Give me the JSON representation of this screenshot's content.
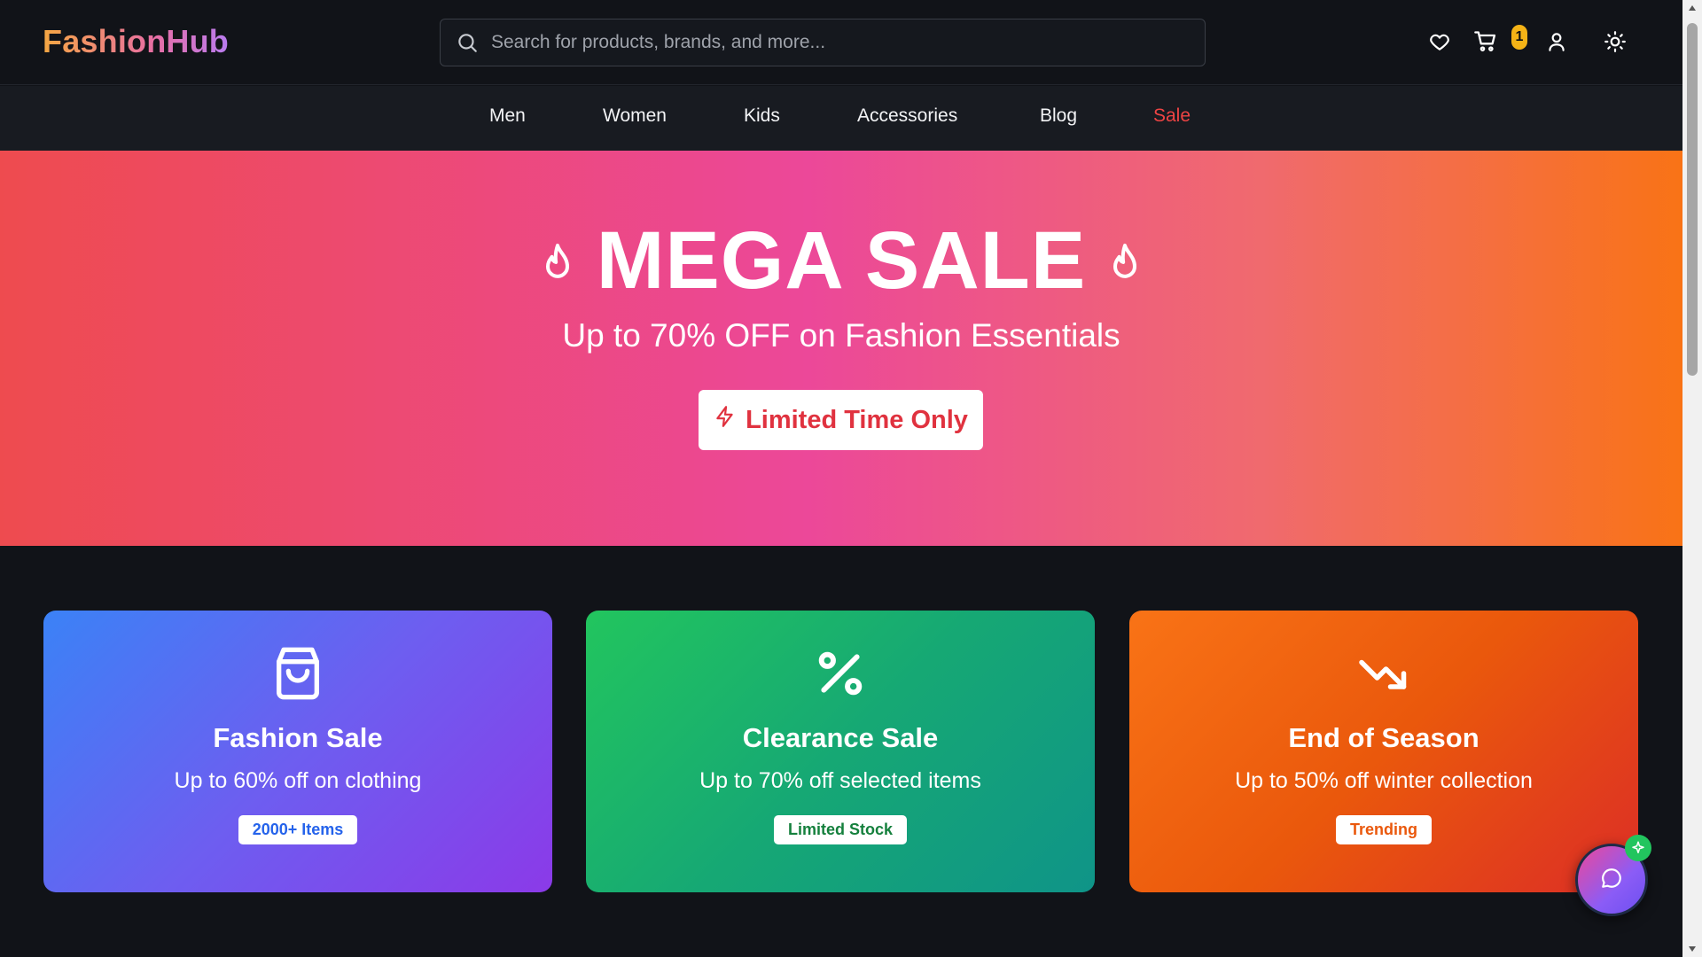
{
  "header": {
    "logo": "FashionHub",
    "search_placeholder": "Search for products, brands, and more...",
    "cart_count": "1",
    "icons": [
      "heart-icon",
      "cart-icon",
      "user-icon",
      "sun-icon"
    ]
  },
  "nav": {
    "items": [
      {
        "label": "Men"
      },
      {
        "label": "Women"
      },
      {
        "label": "Kids"
      },
      {
        "label": "Accessories"
      },
      {
        "label": "Blog"
      },
      {
        "label": "Sale",
        "color": "#ef4444"
      }
    ]
  },
  "hero": {
    "title": "MEGA SALE",
    "subtitle": "Up to 70% OFF on Fashion Essentials",
    "button_label": "Limited Time Only",
    "icons": [
      "flame-icon",
      "lightning-icon"
    ]
  },
  "cards": [
    {
      "icon": "shopping-bag-icon",
      "title": "Fashion Sale",
      "description": "Up to 60% off on clothing",
      "badge": "2000+ Items"
    },
    {
      "icon": "percent-icon",
      "title": "Clearance Sale",
      "description": "Up to 70% off selected items",
      "badge": "Limited Stock"
    },
    {
      "icon": "trending-down-icon",
      "title": "End of Season",
      "description": "Up to 50% off winter collection",
      "badge": "Trending"
    }
  ],
  "colors": {
    "background": "#111318",
    "accent_sale": "#ef4444",
    "badge": "#f5b316",
    "chat_spark": "#22c55e"
  },
  "chat": {
    "icon": "chat-bubble-icon",
    "badge_icon": "sparkle-icon"
  }
}
